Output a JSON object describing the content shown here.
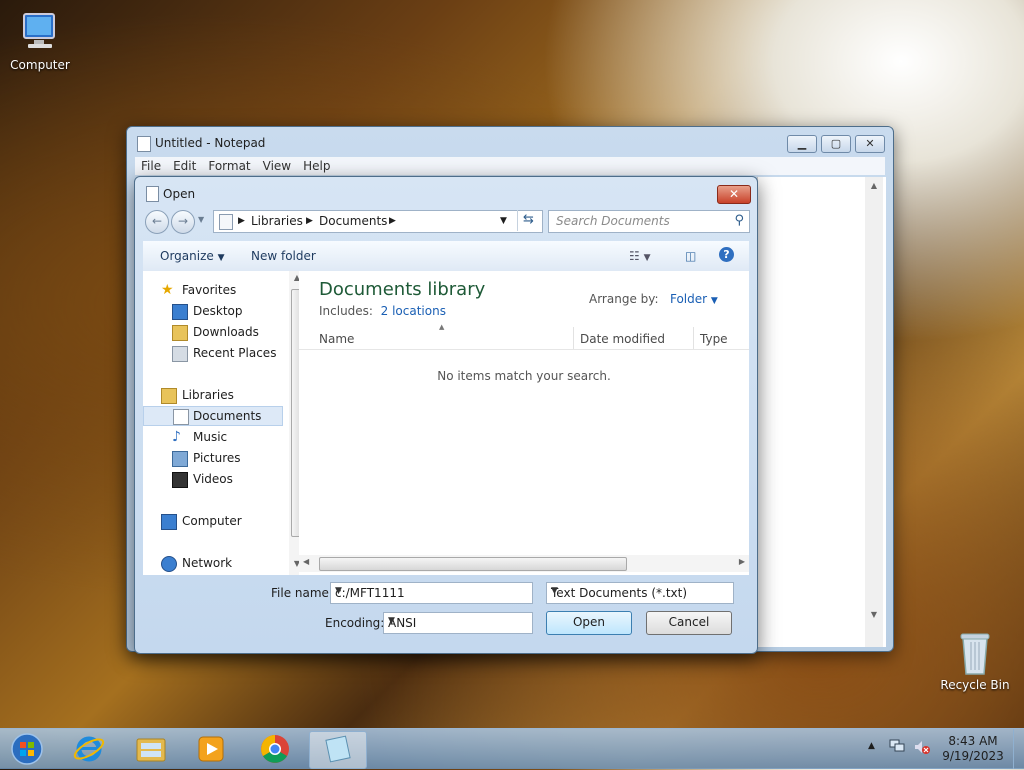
{
  "desktop": {
    "computer_label": "Computer",
    "recycle_label": "Recycle Bin"
  },
  "notepad": {
    "title": "Untitled - Notepad",
    "menu": [
      "File",
      "Edit",
      "Format",
      "View",
      "Help"
    ]
  },
  "dialog": {
    "title": "Open",
    "breadcrumb": [
      "Libraries",
      "Documents"
    ],
    "search_placeholder": "Search Documents",
    "toolbar": {
      "organize": "Organize",
      "new_folder": "New folder"
    },
    "nav": {
      "favorites": "Favorites",
      "desktop": "Desktop",
      "downloads": "Downloads",
      "recent": "Recent Places",
      "libraries": "Libraries",
      "documents": "Documents",
      "music": "Music",
      "pictures": "Pictures",
      "videos": "Videos",
      "computer": "Computer",
      "network": "Network"
    },
    "library_title": "Documents library",
    "includes_label": "Includes:",
    "includes_link": "2 locations",
    "arrange_label": "Arrange by:",
    "arrange_value": "Folder",
    "columns": [
      "Name",
      "Date modified",
      "Type"
    ],
    "empty_message": "No items match your search.",
    "filename_label": "File name:",
    "filename_value": "c:/MFT1111",
    "filetype_value": "Text Documents (*.txt)",
    "encoding_label": "Encoding:",
    "encoding_value": "ANSI",
    "open_label": "Open",
    "cancel_label": "Cancel"
  },
  "taskbar": {
    "time": "8:43 AM",
    "date": "9/19/2023"
  }
}
